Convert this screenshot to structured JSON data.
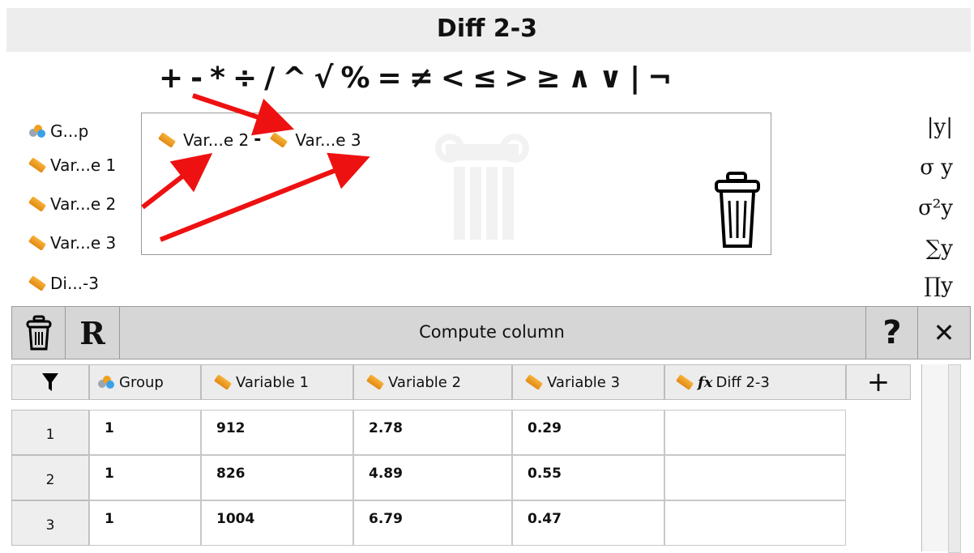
{
  "window": {
    "title": "Diff 2-3"
  },
  "operators": [
    "+",
    "-",
    "*",
    "÷",
    "/",
    "^",
    "√",
    "%",
    "=",
    "≠",
    "<",
    "≤",
    ">",
    "≥",
    "∧",
    "∨",
    "|",
    "¬"
  ],
  "variable_list": [
    {
      "label": "G...p",
      "icon": "group-icon"
    },
    {
      "label": "Var...e 1",
      "icon": "pencil-icon"
    },
    {
      "label": "Var...e 2",
      "icon": "pencil-icon"
    },
    {
      "label": "Var...e 3",
      "icon": "pencil-icon"
    },
    {
      "label": "Di...-3",
      "icon": "pencil-icon"
    }
  ],
  "formula": {
    "tokens": [
      "Var...e 2",
      "-",
      "Var...e 3"
    ]
  },
  "functions": [
    "|y|",
    "σ y",
    "σ²y",
    "∑y",
    "∏y"
  ],
  "toolbar": {
    "compute_label": "Compute column",
    "r_label": "R",
    "help_label": "?",
    "close_label": "✕"
  },
  "table": {
    "columns": [
      "Group",
      "Variable 1",
      "Variable 2",
      "Variable 3",
      "Diff 2-3"
    ],
    "add_label": "+",
    "rows": [
      {
        "index": "1",
        "cells": [
          "1",
          "912",
          "2.78",
          "0.29",
          ""
        ]
      },
      {
        "index": "2",
        "cells": [
          "1",
          "826",
          "4.89",
          "0.55",
          ""
        ]
      },
      {
        "index": "3",
        "cells": [
          "1",
          "1004",
          "6.79",
          "0.47",
          ""
        ]
      }
    ]
  },
  "colors": {
    "arrow": "#ee1111",
    "pencil": "#f0a020",
    "toolbar": "#d6d6d6"
  }
}
